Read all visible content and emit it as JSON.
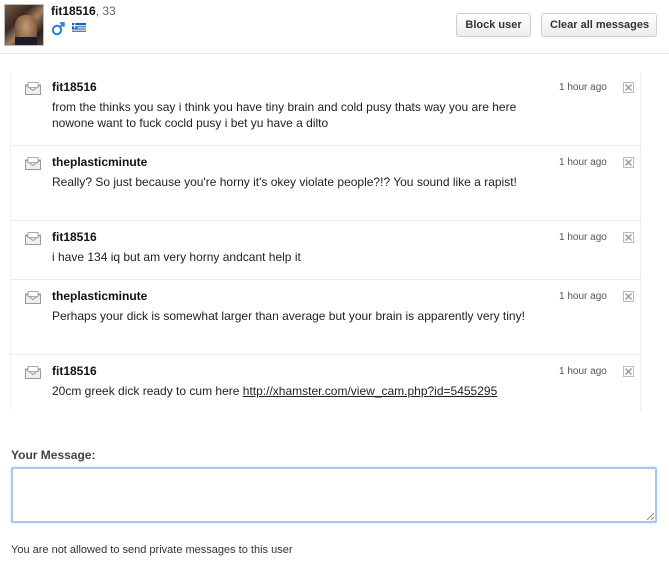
{
  "profile": {
    "username": "fit18516",
    "age_text": ", 33",
    "gender_icon": "male-symbol-icon",
    "flag_icon": "greece-flag-icon",
    "accent_color": "#2a7fd4"
  },
  "actions": {
    "block_label": "Block user",
    "clear_label": "Clear all messages"
  },
  "messages": [
    {
      "sender": "fit18516",
      "text": "from the thinks you say i think you have tiny brain and cold pusy thats way you are here nowone want to fuck cocld pusy i bet yu have a dilto",
      "time": "1 hour ago"
    },
    {
      "sender": "theplasticminute",
      "text": "Really? So just because you're horny it's okey violate people?!? You sound like a rapist!",
      "time": "1 hour ago"
    },
    {
      "sender": "fit18516",
      "text": "i have 134 iq but am very horny andcant help it",
      "time": "1 hour ago"
    },
    {
      "sender": "theplasticminute",
      "text": "Perhaps your dick is somewhat larger than average but your brain is apparently very tiny!",
      "time": "1 hour ago"
    },
    {
      "sender": "fit18516",
      "text_before": "20cm greek dick ready to cum here ",
      "link": "http://xhamster.com/view_cam.php?id=5455295",
      "time": "1 hour ago"
    }
  ],
  "compose": {
    "label": "Your Message:",
    "value": "",
    "notice": "You are not allowed to send private messages to this user"
  }
}
